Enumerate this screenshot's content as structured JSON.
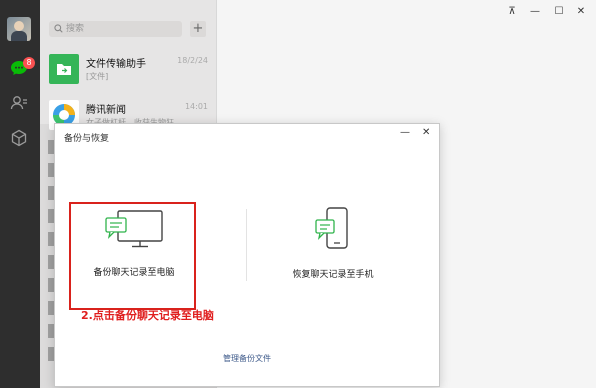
{
  "sidebar": {
    "unread_badge": "8",
    "icons": [
      "avatar",
      "chat-icon",
      "contacts-icon",
      "box-icon"
    ]
  },
  "search": {
    "placeholder": "搜索",
    "add_button": "+"
  },
  "chats": [
    {
      "name": "文件传输助手",
      "time": "18/2/24",
      "preview": "[文件]"
    },
    {
      "name": "腾讯新闻",
      "time": "14:01",
      "preview": "女子做杠杆，收获生物狂"
    }
  ],
  "window_controls": {
    "pin": "⊼",
    "minimize": "—",
    "maximize": "☐",
    "close": "✕"
  },
  "dialog": {
    "title": "备份与恢复",
    "minimize": "—",
    "close": "✕",
    "backup_label": "备份聊天记录至电脑",
    "restore_label": "恢复聊天记录至手机",
    "manage_link": "管理备份文件"
  },
  "annotation": "2.点击备份聊天记录至电脑",
  "colors": {
    "accent_green": "#09bb07",
    "highlight_red": "#d9221c",
    "badge_red": "#fa5151"
  }
}
